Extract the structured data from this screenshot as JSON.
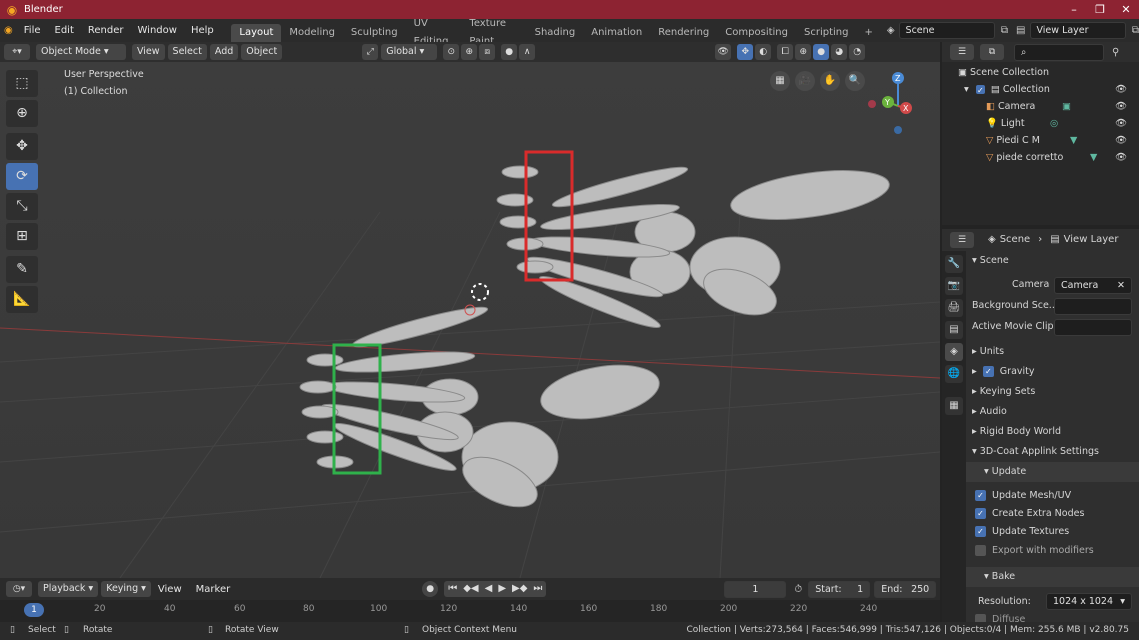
{
  "window": {
    "title": "Blender"
  },
  "menus": [
    "File",
    "Edit",
    "Render",
    "Window",
    "Help"
  ],
  "workspaces": [
    "Layout",
    "Modeling",
    "Sculpting",
    "UV Editing",
    "Texture Paint",
    "Shading",
    "Animation",
    "Rendering",
    "Compositing",
    "Scripting"
  ],
  "active_workspace": "Layout",
  "scene_field": "Scene",
  "viewlayer_field": "View Layer",
  "viewport_header": {
    "mode": "Object Mode",
    "menus": [
      "View",
      "Select",
      "Add",
      "Object"
    ],
    "orientation": "Global"
  },
  "viewport": {
    "perspective": "User Perspective",
    "collection": "(1) Collection",
    "gizmo": {
      "z": "Z",
      "y": "Y",
      "x": "X"
    }
  },
  "outliner": {
    "root": "Scene Collection",
    "items": [
      {
        "label": "Collection",
        "level": 1
      },
      {
        "label": "Camera",
        "level": 2
      },
      {
        "label": "Light",
        "level": 2
      },
      {
        "label": "Piedi C M",
        "level": 2
      },
      {
        "label": "piede corretto",
        "level": 2
      }
    ]
  },
  "properties": {
    "breadcrumb_scene": "Scene",
    "breadcrumb_layer": "View Layer",
    "panel_title": "Scene",
    "camera_label": "Camera",
    "camera_value": "Camera",
    "background_label": "Background Sce...",
    "movieclip_label": "Active Movie Clip",
    "units": "Units",
    "gravity": "Gravity",
    "keying_sets": "Keying Sets",
    "audio": "Audio",
    "rigid_body": "Rigid Body World",
    "applink": "3D-Coat Applink Settings",
    "update": "Update",
    "update_mesh": "Update Mesh/UV",
    "extra_nodes": "Create Extra Nodes",
    "update_textures": "Update Textures",
    "export_mod": "Export with modifiers",
    "bake": "Bake",
    "resolution_label": "Resolution:",
    "resolution_value": "1024 x 1024",
    "diffuse": "Diffuse"
  },
  "timeline": {
    "playback": "Playback",
    "keying": "Keying",
    "view": "View",
    "marker": "Marker",
    "current_frame": "1",
    "start_label": "Start:",
    "start": "1",
    "end_label": "End:",
    "end": "250",
    "ticks": [
      "1",
      "20",
      "40",
      "60",
      "80",
      "100",
      "120",
      "140",
      "160",
      "180",
      "200",
      "220",
      "240"
    ]
  },
  "status": {
    "select": "Select",
    "rotate": "Rotate",
    "rotate_view": "Rotate View",
    "context_menu": "Object Context Menu",
    "stats": "Collection | Verts:273,564 | Faces:546,999 | Tris:547,126 | Objects:0/4 | Mem: 255.6 MB | v2.80.75"
  },
  "colors": {
    "accent": "#4772b3",
    "title_bar": "#8d2332",
    "red_box": "#d92b2b",
    "green_box": "#2fb14b"
  }
}
